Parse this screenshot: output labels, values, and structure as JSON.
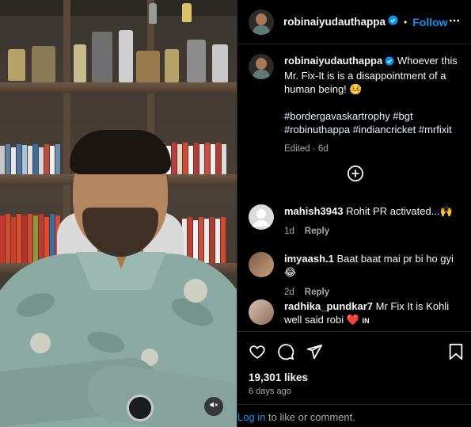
{
  "colors": {
    "accent": "#0095f6",
    "verified": "#0095f6",
    "muted": "#a8a8a8",
    "heart": "#ed4956"
  },
  "video": {
    "mute_icon": "speaker-muted-icon"
  },
  "header": {
    "username": "robinaiyudauthappa",
    "dot": "•",
    "follow_label": "Follow",
    "more_icon": "more-horizontal-icon"
  },
  "caption": {
    "username": "robinaiyudauthappa",
    "text": "Whoever this Mr. Fix-It is is a disappointment of a human being! 🤒",
    "hashtags": "#bordergavaskartrophy #bgt #robinuthappa #indiancricket #mrfixit",
    "edited": "Edited",
    "time": "6d"
  },
  "load_more_icon": "plus-circle-icon",
  "comments": [
    {
      "username": "mahish3943",
      "text": "Rohit PR activated...🙌",
      "time": "1d",
      "reply": "Reply"
    },
    {
      "username": "imyaash.1",
      "text": "Baat baat mai pr bi ho gyi😂",
      "time": "2d",
      "reply": "Reply"
    },
    {
      "username": "radhika_pundkar7",
      "text": "Mr Fix It is Kohli well said robi",
      "heart": "❤️",
      "flag": "IN"
    }
  ],
  "actions": {
    "like_icon": "heart-icon",
    "comment_icon": "comment-icon",
    "share_icon": "share-icon",
    "save_icon": "bookmark-icon"
  },
  "likes": "19,301 likes",
  "posted": "6 days ago",
  "login": {
    "link": "Log in",
    "rest": " to like or comment."
  }
}
